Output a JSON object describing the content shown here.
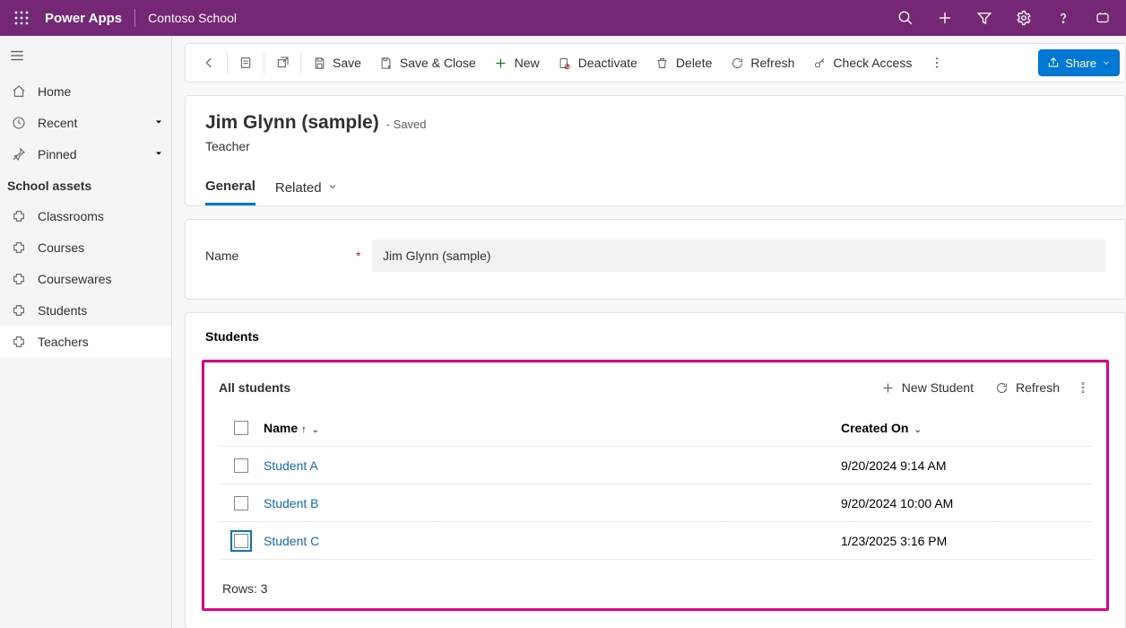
{
  "header": {
    "app_title": "Power Apps",
    "env_name": "Contoso School"
  },
  "nav": {
    "top": [
      {
        "label": "Home"
      },
      {
        "label": "Recent"
      },
      {
        "label": "Pinned"
      }
    ],
    "group_title": "School assets",
    "assets": [
      {
        "label": "Classrooms"
      },
      {
        "label": "Courses"
      },
      {
        "label": "Coursewares"
      },
      {
        "label": "Students"
      },
      {
        "label": "Teachers"
      }
    ]
  },
  "commands": {
    "save": "Save",
    "save_close": "Save & Close",
    "new": "New",
    "deactivate": "Deactivate",
    "delete": "Delete",
    "refresh": "Refresh",
    "check_access": "Check Access",
    "share": "Share"
  },
  "record": {
    "title": "Jim Glynn (sample)",
    "saved_text": "- Saved",
    "entity": "Teacher"
  },
  "tabs": {
    "general": "General",
    "related": "Related"
  },
  "fields": {
    "name_label": "Name",
    "name_value": "Jim Glynn (sample)"
  },
  "section": {
    "title": "Students"
  },
  "subgrid": {
    "title": "All students",
    "new_label": "New Student",
    "refresh_label": "Refresh",
    "columns": {
      "name": "Name",
      "created": "Created On"
    },
    "rows": [
      {
        "name": "Student A",
        "created": "9/20/2024 9:14 AM"
      },
      {
        "name": "Student B",
        "created": "9/20/2024 10:00 AM"
      },
      {
        "name": "Student C",
        "created": "1/23/2025 3:16 PM"
      }
    ],
    "rowcount_label": "Rows: 3"
  }
}
